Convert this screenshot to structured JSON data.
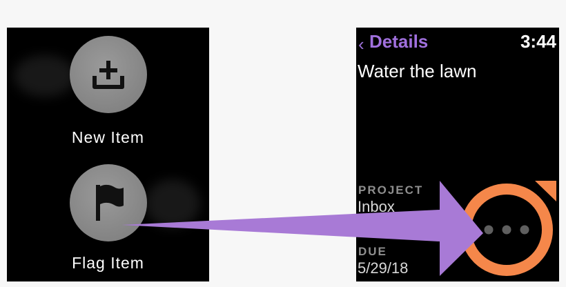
{
  "left_screen": {
    "items": [
      {
        "label": "New Item",
        "icon": "inbox-add-icon"
      },
      {
        "label": "Flag Item",
        "icon": "flag-icon"
      }
    ]
  },
  "right_screen": {
    "back_label": "Details",
    "time": "3:44",
    "title": "Water the lawn",
    "project_label": "PROJECT",
    "project_value": "Inbox",
    "due_label": "DUE",
    "due_value": "5/29/18"
  },
  "colors": {
    "accent_purple": "#a070dd",
    "arrow": "#a87ad6",
    "highlight_orange": "#f5874a"
  }
}
